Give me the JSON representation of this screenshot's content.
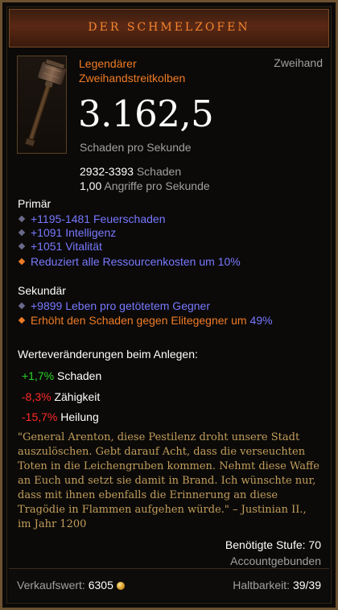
{
  "header": {
    "title": "DER SCHMELZOFEN"
  },
  "item": {
    "type_line1": "Legendärer",
    "type_line2": "Zweihandstreitkolben",
    "slot": "Zweihand",
    "dps": "3.162,5",
    "dps_label": "Schaden pro Sekunde",
    "damage_range": "2932-3393",
    "damage_label": "Schaden",
    "attack_speed": "1,00",
    "attack_speed_label": "Angriffe pro Sekunde"
  },
  "primary": {
    "title": "Primär",
    "affixes": [
      "+1195-1481 Feuerschaden",
      "+1091 Intelligenz",
      "+1051 Vitalität",
      "Reduziert alle Ressourcenkosten um 10%"
    ]
  },
  "secondary": {
    "title": "Sekundär",
    "affix1": "+9899 Leben pro getötetem Gegner",
    "affix2_text": "Erhöht den Schaden gegen Elitegegner um ",
    "affix2_value": "49%"
  },
  "changes": {
    "title": "Werteveränderungen beim Anlegen:",
    "items": [
      {
        "value": "+1,7%",
        "label": "Schaden"
      },
      {
        "value": "-8,3%",
        "label": "Zähigkeit"
      },
      {
        "value": "-15,7%",
        "label": "Heilung"
      }
    ]
  },
  "flavor": {
    "text": "\"General Arenton, diese Pestilenz droht unsere Stadt auszulöschen. Gebt darauf Acht, dass die verseuchten Toten in die Leichengruben kommen. Nehmt diese Waffe an Euch und setzt sie damit in Brand. Ich wünschte nur, dass mit ihnen ebenfalls die Erinnerung an diese Tragödie in Flammen aufgehen würde.\" – Justinian II., im Jahr 1200"
  },
  "requirements": {
    "level": "Benötigte Stufe: 70",
    "bound": "Accountgebunden"
  },
  "footer": {
    "sell_label": "Verkaufswert:",
    "sell_value": "6305",
    "durability_label": "Haltbarkeit:",
    "durability_value": "39/39"
  },
  "colors": {
    "legendary": "#f07b26",
    "magic": "#7878ff",
    "positive": "#27d527",
    "negative": "#ff2a2a",
    "flavor": "#c39e5c"
  },
  "icons": [
    "war-hammer-icon",
    "gold-coin-icon"
  ]
}
